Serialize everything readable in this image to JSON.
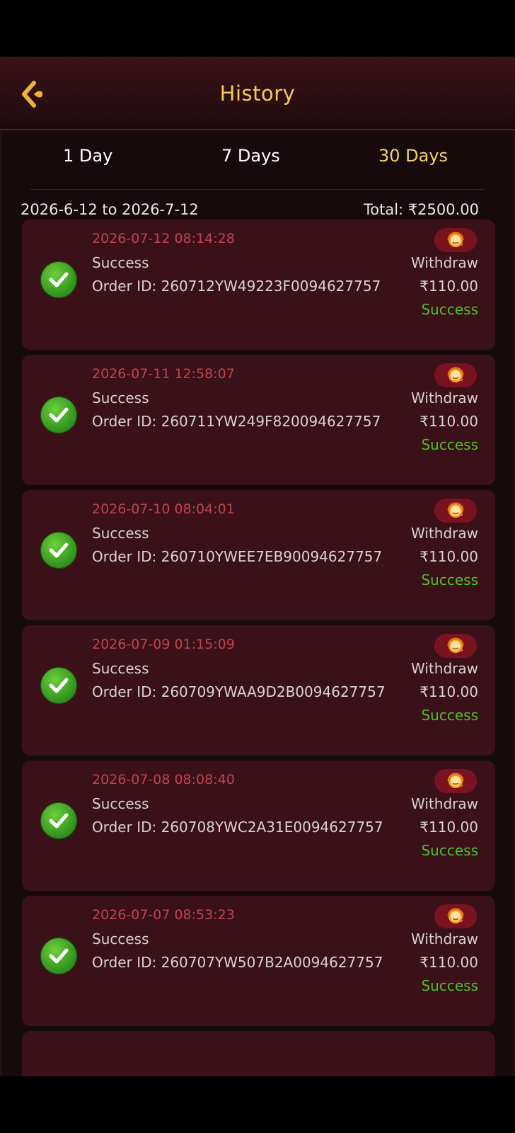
{
  "header": {
    "title": "History"
  },
  "tabs": [
    {
      "label": "1 Day",
      "active": false
    },
    {
      "label": "7 Days",
      "active": false
    },
    {
      "label": "30 Days",
      "active": true
    }
  ],
  "summary": {
    "range": "2026-6-12 to 2026-7-12",
    "total": "Total: ₹2500.00"
  },
  "records": [
    {
      "time": "2026-07-12 08:14:28",
      "status": "Success",
      "order_id": "Order ID: 260712YW49223F0094627757",
      "type": "Withdraw",
      "amount": "₹110.00",
      "result": "Success"
    },
    {
      "time": "2026-07-11 12:58:07",
      "status": "Success",
      "order_id": "Order ID: 260711YW249F820094627757",
      "type": "Withdraw",
      "amount": "₹110.00",
      "result": "Success"
    },
    {
      "time": "2026-07-10 08:04:01",
      "status": "Success",
      "order_id": "Order ID: 260710YWEE7EB90094627757",
      "type": "Withdraw",
      "amount": "₹110.00",
      "result": "Success"
    },
    {
      "time": "2026-07-09 01:15:09",
      "status": "Success",
      "order_id": "Order ID: 260709YWAA9D2B0094627757",
      "type": "Withdraw",
      "amount": "₹110.00",
      "result": "Success"
    },
    {
      "time": "2026-07-08 08:08:40",
      "status": "Success",
      "order_id": "Order ID: 260708YWC2A31E0094627757",
      "type": "Withdraw",
      "amount": "₹110.00",
      "result": "Success"
    },
    {
      "time": "2026-07-07 08:53:23",
      "status": "Success",
      "order_id": "Order ID: 260707YW507B2A0094627757",
      "type": "Withdraw",
      "amount": "₹110.00",
      "result": "Success"
    }
  ],
  "colors": {
    "accent": "#f5c85a",
    "time_red": "#c0434d",
    "success_green": "#4fbf2a",
    "card_bg": "#3a1119"
  },
  "icons": {
    "back": "back-arrow-icon",
    "status": "check-circle-icon",
    "support": "customer-service-icon"
  }
}
